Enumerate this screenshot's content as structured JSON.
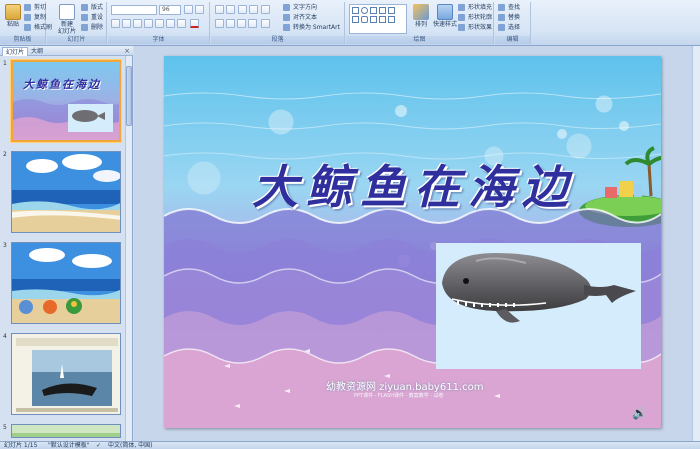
{
  "ribbon": {
    "clipboard": {
      "group_label": "剪贴板",
      "paste": "粘贴",
      "cut": "剪切",
      "copy": "复制",
      "format_painter": "格式刷"
    },
    "slides": {
      "group_label": "幻灯片",
      "new_slide": "新建\n幻灯片",
      "layout": "版式",
      "reset": "重设",
      "delete": "删除"
    },
    "font": {
      "group_label": "字体",
      "font_name": "",
      "font_size": "96"
    },
    "paragraph": {
      "group_label": "段落",
      "text_direction": "文字方向",
      "align_text": "对齐文本",
      "convert_smartart": "转换为 SmartArt"
    },
    "drawing": {
      "group_label": "绘图",
      "arrange": "排列",
      "quick_styles": "快速样式",
      "shape_fill": "形状填充",
      "shape_outline": "形状轮廓",
      "shape_effects": "形状效果"
    },
    "editing": {
      "group_label": "编辑",
      "find": "查找",
      "replace": "替换",
      "select": "选择"
    }
  },
  "panel": {
    "tab_slides": "幻灯片",
    "tab_outline": "大纲",
    "close": "×",
    "thumbnails": [
      {
        "num": "1",
        "title": "大鲸鱼在海边"
      },
      {
        "num": "2",
        "title": ""
      },
      {
        "num": "3",
        "title": ""
      },
      {
        "num": "4",
        "title": ""
      },
      {
        "num": "5",
        "title": ""
      }
    ]
  },
  "slide": {
    "title": "大鲸鱼在海边",
    "watermark": "幼教资源网 ziyuan.baby611.com",
    "watermark_sub": "PPT课件 · FLASH课件 · 教案教学 · 试卷"
  },
  "status": {
    "slide_counter": "幻灯片 1/15",
    "theme": "\"默认设计模板\"",
    "language": "中文(简体, 中国)"
  },
  "colors": {
    "ribbon_bg": "#d6e4f5",
    "title_color": "#2f2f9e",
    "selected_thumb": "#f3a73b"
  }
}
